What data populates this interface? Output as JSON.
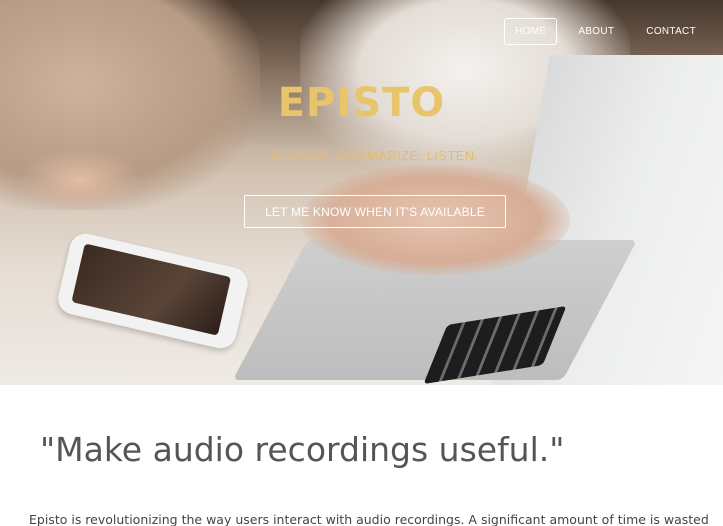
{
  "nav": {
    "items": [
      {
        "label": "HOME",
        "active": true
      },
      {
        "label": "ABOUT",
        "active": false
      },
      {
        "label": "CONTACT",
        "active": false
      }
    ]
  },
  "hero": {
    "brand": "EPISTO",
    "tagline": "RECORD. SUMMARIZE. LISTEN.",
    "cta_label": "LET ME KNOW WHEN IT'S AVAILABLE"
  },
  "content": {
    "quote": "\"Make audio recordings useful.\"",
    "intro": "Episto is revolutionizing the way users interact with audio recordings. A significant amount of time is wasted"
  },
  "colors": {
    "accent": "#e8c46a",
    "nav_text": "#ffffff",
    "body_text": "#555555"
  }
}
